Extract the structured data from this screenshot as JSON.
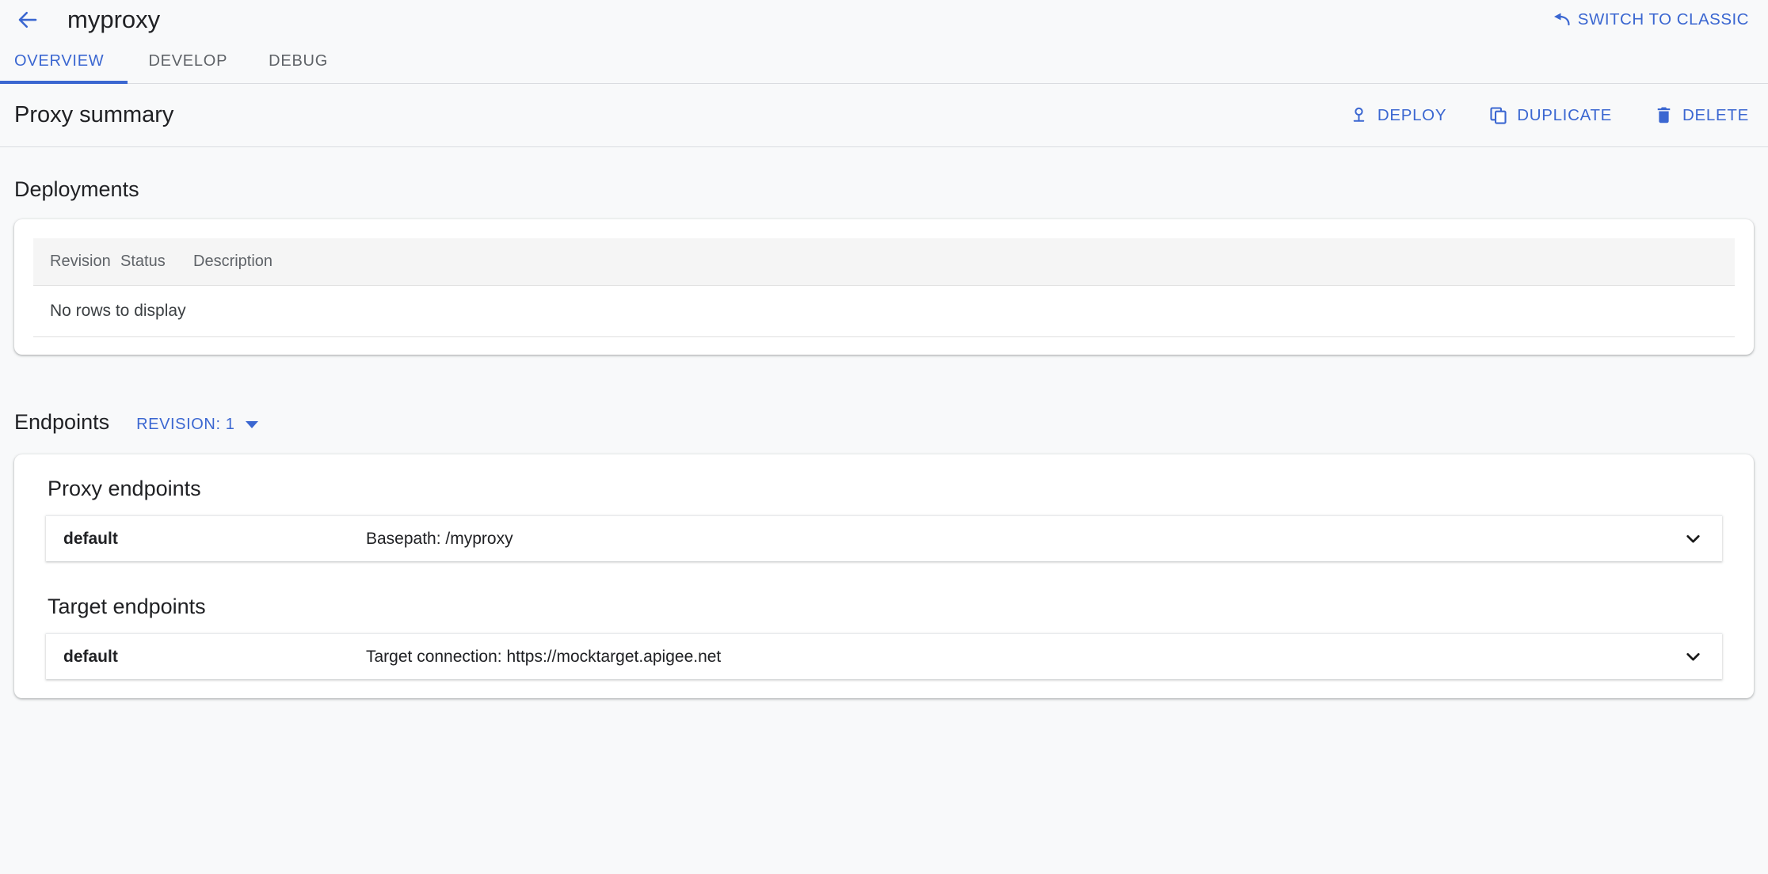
{
  "titlebar": {
    "back_icon": "arrow-back-icon",
    "proxy_name": "myproxy",
    "switch_classic_label": "SWITCH TO CLASSIC",
    "switch_classic_icon": "undo-arrow-icon"
  },
  "tabs": [
    {
      "label": "OVERVIEW",
      "active": true
    },
    {
      "label": "DEVELOP",
      "active": false
    },
    {
      "label": "DEBUG",
      "active": false
    }
  ],
  "summary": {
    "title": "Proxy summary",
    "actions": [
      {
        "label": "DEPLOY",
        "icon": "deploy-pin-icon"
      },
      {
        "label": "DUPLICATE",
        "icon": "copy-icon"
      },
      {
        "label": "DELETE",
        "icon": "trash-icon"
      }
    ]
  },
  "deployments": {
    "title": "Deployments",
    "columns": [
      "Revision",
      "Status",
      "Description"
    ],
    "empty_message": "No rows to display",
    "rows": []
  },
  "endpoints": {
    "title": "Endpoints",
    "revision_label": "REVISION: 1",
    "groups": [
      {
        "title": "Proxy endpoints",
        "items": [
          {
            "name": "default",
            "detail": "Basepath: /myproxy",
            "chevron": "chevron-down-icon"
          }
        ]
      },
      {
        "title": "Target endpoints",
        "items": [
          {
            "name": "default",
            "detail": "Target connection: https://mocktarget.apigee.net",
            "chevron": "chevron-down-icon"
          }
        ]
      }
    ]
  },
  "colors": {
    "accent": "#3b67d1",
    "page_background": "#f8f9fa",
    "card_background": "#ffffff",
    "text_primary": "#202124",
    "text_secondary": "#5f6368",
    "divider": "#dadce0"
  }
}
